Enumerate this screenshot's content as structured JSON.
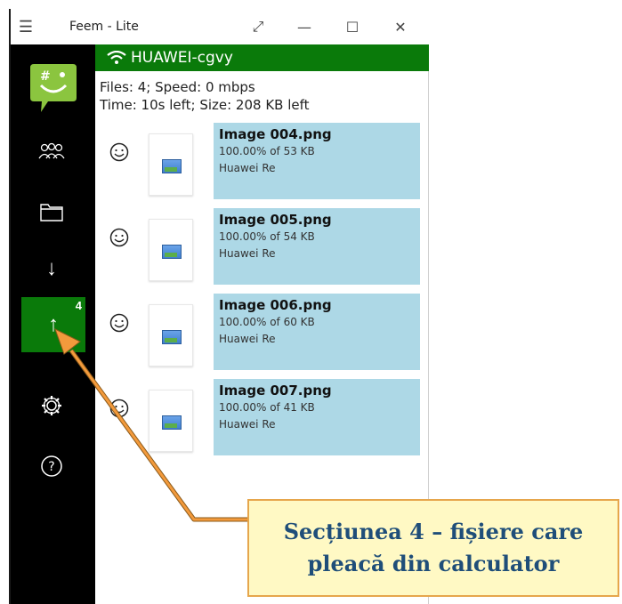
{
  "window": {
    "title": "Feem - Lite"
  },
  "header": {
    "network_name": "HUAWEI-cgvy"
  },
  "stats": {
    "line1": "Files: 4; Speed: 0 mbps",
    "line2": "Time: 10s left; Size:  208 KB left"
  },
  "sidebar": {
    "outgoing_badge": "4"
  },
  "files": [
    {
      "name": "Image 004.png",
      "progress": "100.00% of 53 KB",
      "device": "Huawei Re"
    },
    {
      "name": "Image 005.png",
      "progress": "100.00% of 54 KB",
      "device": "Huawei Re"
    },
    {
      "name": "Image 006.png",
      "progress": "100.00% of 60 KB",
      "device": "Huawei Re"
    },
    {
      "name": "Image 007.png",
      "progress": "100.00% of 41 KB",
      "device": "Huawei Re"
    }
  ],
  "callout": {
    "line1": "Secțiunea 4 – fișiere care",
    "line2": "pleacă din calculator"
  },
  "colors": {
    "accent_green": "#0a7a0a",
    "card_blue": "#add8e6",
    "callout_bg": "#fff9c4",
    "callout_border": "#e6a64c",
    "callout_text": "#1f4e79",
    "arrow": "#f39a3c"
  }
}
